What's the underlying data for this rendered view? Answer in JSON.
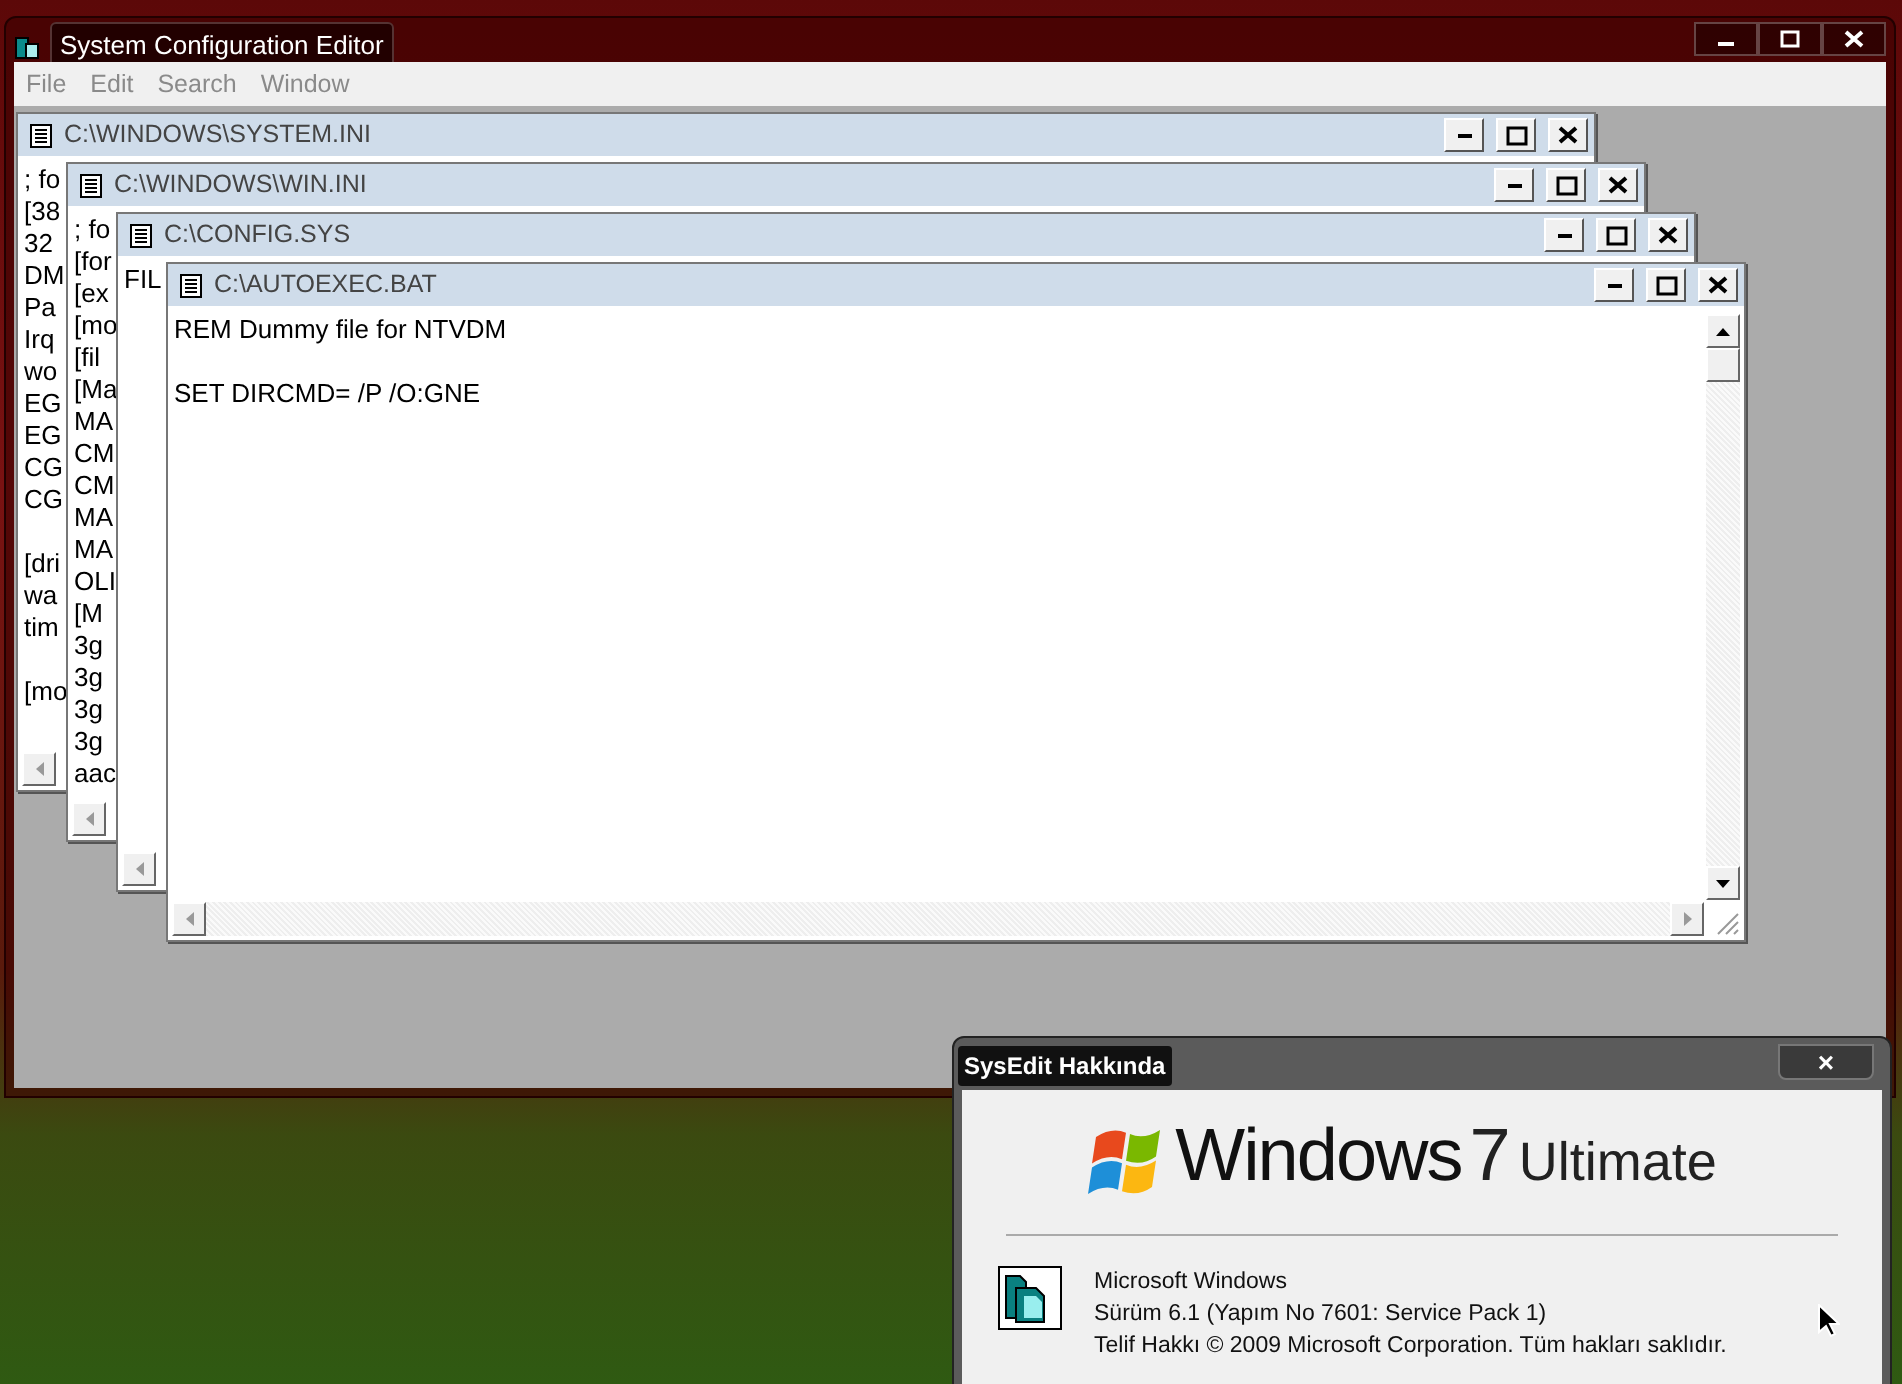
{
  "main_window": {
    "title": "System Configuration Editor",
    "menu": [
      "File",
      "Edit",
      "Search",
      "Window"
    ]
  },
  "documents": [
    {
      "title": "C:\\WINDOWS\\SYSTEM.INI",
      "blocks": [
        [
          "; fo",
          "[38",
          "32",
          "DM",
          "Pa",
          "Irq",
          "wo",
          "EG",
          "EG",
          "CG",
          "CG"
        ],
        [
          "[dri",
          "wa",
          "tim"
        ],
        [
          "[mo"
        ]
      ]
    },
    {
      "title": "C:\\WINDOWS\\WIN.INI",
      "blocks": [
        [
          "; fo",
          "[for",
          "[ex",
          "[mo",
          "[fil",
          "[Ma",
          "MA",
          "CM",
          "CM",
          "MA",
          "MA",
          "OLI",
          "[M",
          "3g",
          "3g",
          "3g",
          "3g",
          "aac"
        ]
      ]
    },
    {
      "title": "C:\\CONFIG.SYS",
      "blocks": [
        [
          "FIL"
        ]
      ]
    },
    {
      "title": "C:\\AUTOEXEC.BAT",
      "blocks": [
        [
          "REM Dummy file for NTVDM"
        ],
        [
          "SET DIRCMD= /P /O:GNE"
        ]
      ]
    }
  ],
  "about_dialog": {
    "title": "SysEdit Hakkında",
    "close": "×",
    "logo": {
      "brand": "Windows",
      "version": "7",
      "edition": "Ultimate"
    },
    "lines": [
      "Microsoft Windows",
      "Sürüm 6.1 (Yapım No 7601: Service Pack 1)",
      "Telif Hakkı © 2009 Microsoft Corporation. Tüm hakları saklıdır."
    ]
  }
}
